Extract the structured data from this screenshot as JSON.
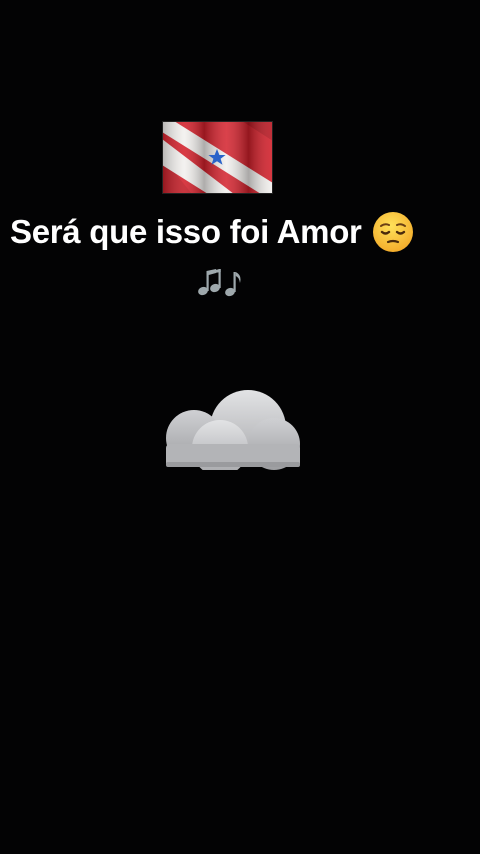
{
  "story": {
    "caption": "Será que isso foi Amor",
    "icons": {
      "flag": "para-state-flag-icon",
      "face": "pensive-face-emoji",
      "notes": "musical-notes-emoji",
      "cloud": "cloud-emoji"
    }
  },
  "colors": {
    "background": "#030304",
    "text": "#ffffff",
    "flag_red": "#d3202b",
    "flag_white": "#f2f0ee",
    "flag_star": "#2a63c9",
    "emoji_yellow": "#f8c52c",
    "cloud_gray": "#b9babd",
    "notes_gray": "#9ea8ac"
  }
}
